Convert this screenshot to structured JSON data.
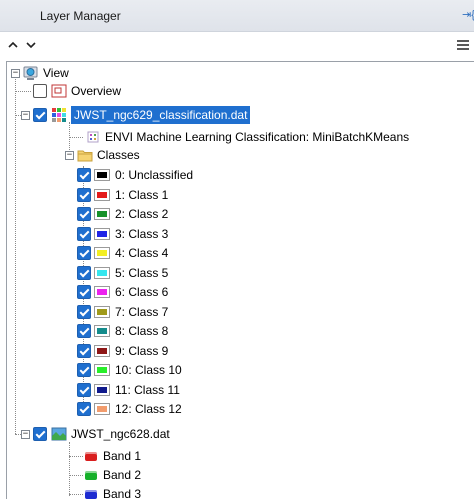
{
  "panel": {
    "title": "Layer Manager"
  },
  "toolbar": {
    "up_icon": "chevron-up-icon",
    "down_icon": "chevron-down-icon",
    "menu_icon": "hamburger-menu-icon"
  },
  "tree": {
    "root_label": "View",
    "overview_label": "Overview",
    "classification_file": "JWST_ngc629_classification.dat",
    "algorithm_label": "ENVI Machine Learning Classification: MiniBatchKMeans",
    "classes_folder": "Classes",
    "classes": [
      {
        "label": "0: Unclassified",
        "color": "#000000"
      },
      {
        "label": "1: Class 1",
        "color": "#e41b1b"
      },
      {
        "label": "2: Class 2",
        "color": "#17922a"
      },
      {
        "label": "3: Class 3",
        "color": "#1f24e6"
      },
      {
        "label": "4: Class 4",
        "color": "#f3ee22"
      },
      {
        "label": "5: Class 5",
        "color": "#35e6ee"
      },
      {
        "label": "6: Class 6",
        "color": "#ec22ee"
      },
      {
        "label": "7: Class 7",
        "color": "#a09a1a"
      },
      {
        "label": "8: Class 8",
        "color": "#158c8c"
      },
      {
        "label": "9: Class 9",
        "color": "#8e1717"
      },
      {
        "label": "10: Class 10",
        "color": "#28ee2a"
      },
      {
        "label": "11: Class 11",
        "color": "#101a8c"
      },
      {
        "label": "12: Class 12",
        "color": "#f29c6d"
      }
    ],
    "image_file": "JWST_ngc628.dat",
    "bands": [
      {
        "label": "Band 1",
        "color": "#d91e1e"
      },
      {
        "label": "Band 2",
        "color": "#16b02a"
      },
      {
        "label": "Band 3",
        "color": "#1d2bd1"
      }
    ]
  }
}
